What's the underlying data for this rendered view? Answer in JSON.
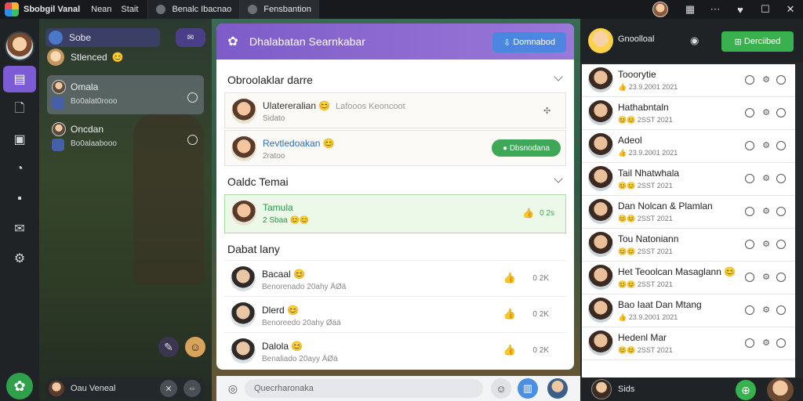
{
  "topbar": {
    "app_title": "Sbobgil Vanal",
    "menus": [
      "Nean",
      "Stait"
    ],
    "tabs": [
      "Benalc Ibacnao",
      "Fensbantion"
    ]
  },
  "rail": {
    "icons": [
      "home-icon",
      "document-icon",
      "gallery-icon",
      "bell-icon",
      "bag-icon",
      "mail-icon",
      "gear-icon"
    ]
  },
  "threads": {
    "header_label": "Sobe",
    "header_button": "✉",
    "status_text": "Stlenced",
    "status_emoji": "😊",
    "items": [
      {
        "name": "Omala",
        "sub": "Bo0alat0rooo"
      },
      {
        "name": "Oncdan",
        "sub": "Bo0alaabooo"
      }
    ],
    "composer_text": "Oau Veneal"
  },
  "panel": {
    "title": "Dhalabatan Searnkabar",
    "header_button": "Domnabod",
    "section1": {
      "title": "Obroolaklar darre",
      "cards": [
        {
          "name": "Ulatereralian 😊",
          "extra": "Lafooos Keoncoot",
          "sub": "Sidato"
        },
        {
          "name": "Revtledoakan 😊",
          "sub": "2ratoo",
          "button": "Dbsnodana"
        }
      ]
    },
    "section2": {
      "title": "Oaldc Temai",
      "card": {
        "name": "Tamula",
        "sub": "2 Sbaa 😊😊",
        "count": "0 2s"
      }
    },
    "section3": {
      "title": "Dabat lany",
      "rows": [
        {
          "name": "Bacaal 😊",
          "sub": "Benorenado 20ahy ÄØä",
          "count": "0 2K"
        },
        {
          "name": "Dlerd 😊",
          "sub": "Benoreedo 20ahy Øää",
          "count": "0 2K"
        },
        {
          "name": "Dalola 😊",
          "sub": "Benaliado 20ayy ÄØä",
          "count": "0 2K"
        }
      ]
    },
    "composer_placeholder": "Quecrharonaka"
  },
  "side": {
    "header_name": "Gnoolloal",
    "header_button": "Derciibed",
    "members": [
      {
        "name": "Tooorytie",
        "sub": "👍 23.9.2001 2021"
      },
      {
        "name": "Hathabntaln",
        "sub": "😊😊 2SST 2021"
      },
      {
        "name": "Adeol",
        "sub": "👍 23.9.2001 2021"
      },
      {
        "name": "Tail Nhatwhala",
        "sub": "😊😊 2SST 2021"
      },
      {
        "name": "Dan Nolcan & Plamlan",
        "sub": "😊😊 2SST 2021"
      },
      {
        "name": "Tou Natoniann",
        "sub": "😊😊 2SST 2021"
      },
      {
        "name": "Het Teoolcan Masaglann 😊",
        "sub": "😊😊 2SST 2021"
      },
      {
        "name": "Bao Iaat Dan Mtang",
        "sub": "👍 23.9.2001 2021"
      },
      {
        "name": "Hedenl Mar",
        "sub": "😊😊 2SST 2021"
      }
    ],
    "bottom_text": "Sids"
  }
}
